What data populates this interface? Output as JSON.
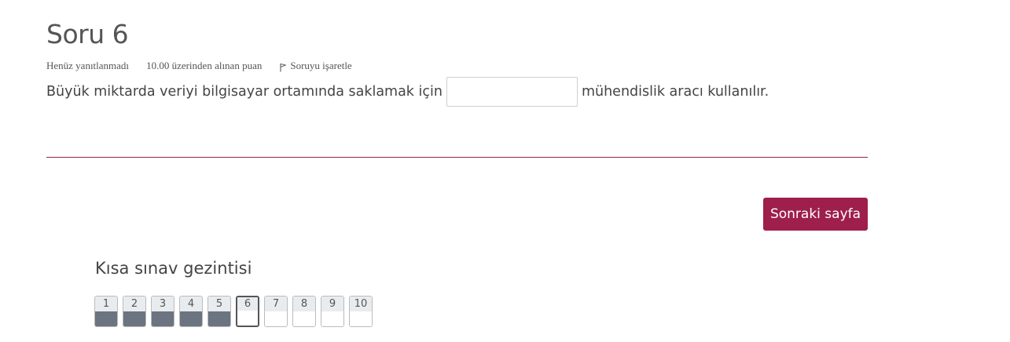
{
  "question": {
    "title": "Soru 6",
    "state": "Henüz yanıtlanmadı",
    "grade": "10.00 üzerinden alınan puan",
    "flag_label": "Soruyu işaretle",
    "text_before": "Büyük miktarda veriyi bilgisayar ortamında saklamak için",
    "answer_value": "",
    "text_after": "mühendislik aracı kullanılır."
  },
  "next_button": {
    "label": "Sonraki sayfa"
  },
  "navigation": {
    "title": "Kısa sınav gezintisi",
    "buttons": [
      {
        "label": "1",
        "status": "answered"
      },
      {
        "label": "2",
        "status": "answered"
      },
      {
        "label": "3",
        "status": "answered"
      },
      {
        "label": "4",
        "status": "answered"
      },
      {
        "label": "5",
        "status": "answered"
      },
      {
        "label": "6",
        "status": "current"
      },
      {
        "label": "7",
        "status": "unanswered"
      },
      {
        "label": "8",
        "status": "unanswered"
      },
      {
        "label": "9",
        "status": "unanswered"
      },
      {
        "label": "10",
        "status": "unanswered"
      }
    ]
  },
  "colors": {
    "accent": "#9e1f4b",
    "divider": "#8f2747",
    "answered": "#6b7480"
  },
  "icons": {
    "flag": "flag-outline-icon"
  }
}
